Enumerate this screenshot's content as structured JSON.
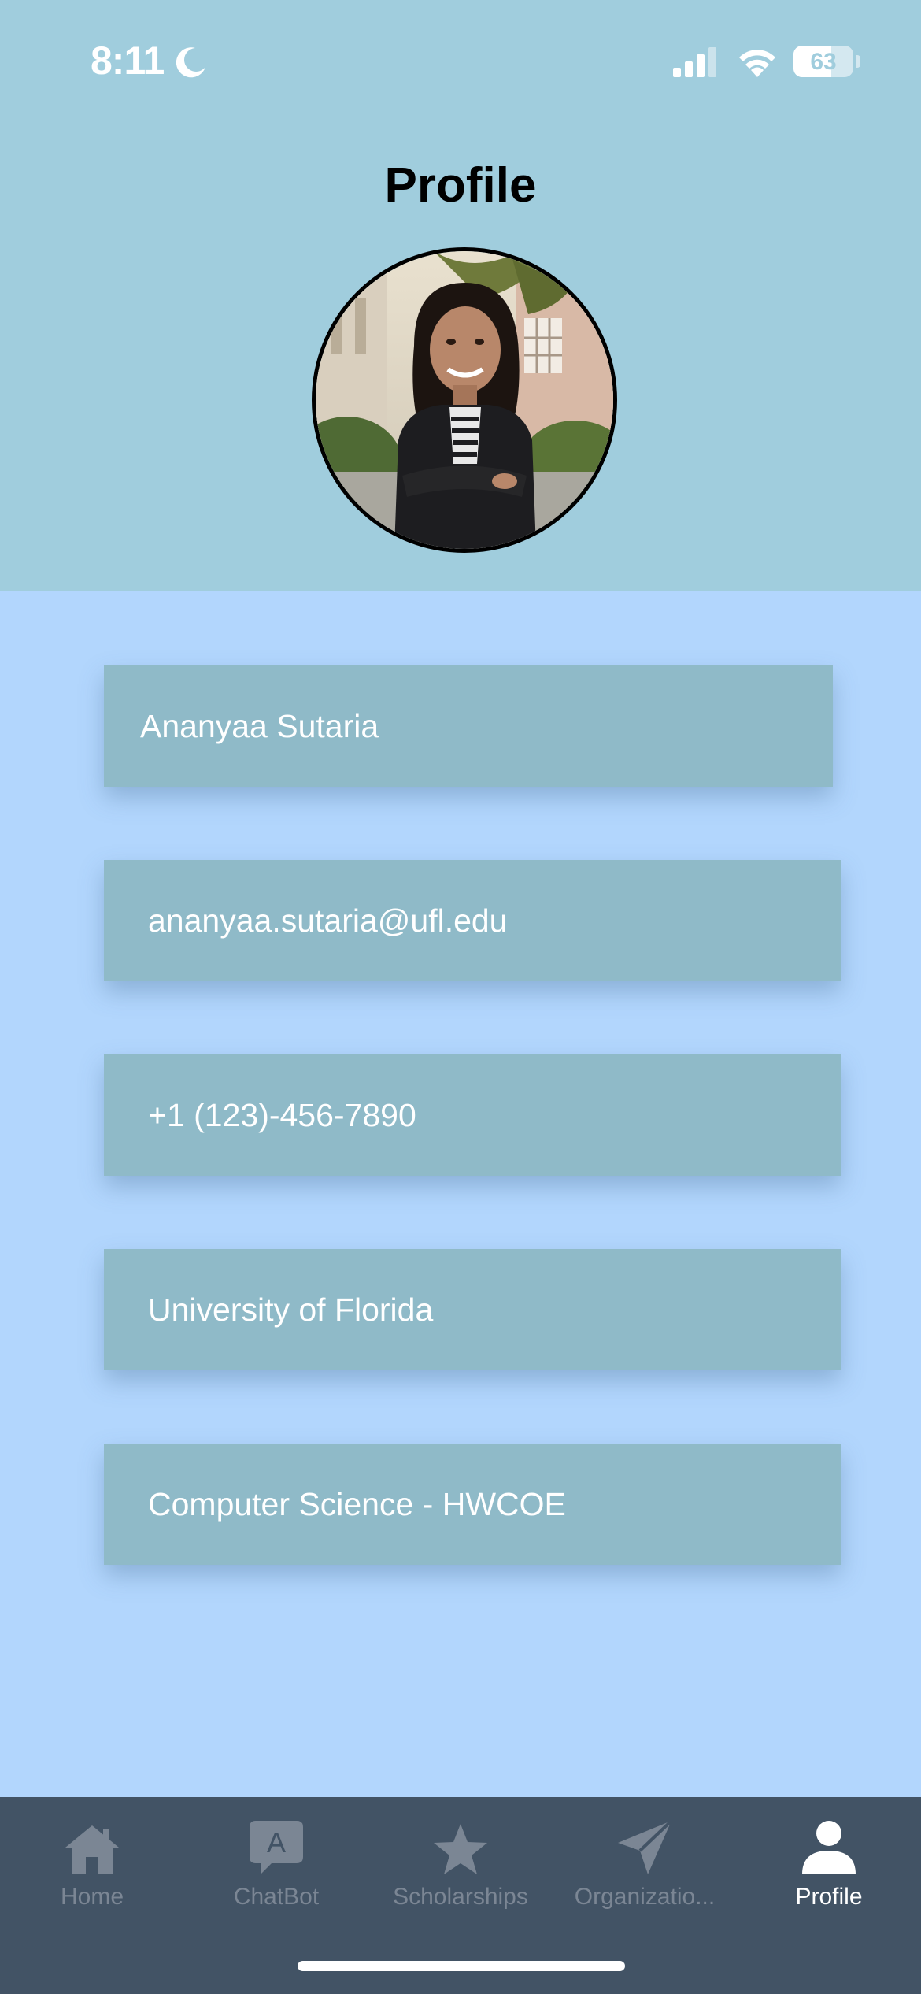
{
  "status_bar": {
    "time": "8:11",
    "battery": "63",
    "battery_level": 0.63
  },
  "header": {
    "title": "Profile"
  },
  "profile": {
    "name": "Ananyaa Sutaria",
    "email": "ananyaa.sutaria@ufl.edu",
    "phone": "+1 (123)-456-7890",
    "university": "University of Florida",
    "major": "Computer Science - HWCOE"
  },
  "tabs": [
    {
      "label": "Home",
      "icon": "home-icon",
      "active": false
    },
    {
      "label": "ChatBot",
      "icon": "chat-bubble-icon",
      "active": false
    },
    {
      "label": "Scholarships",
      "icon": "star-icon",
      "active": false
    },
    {
      "label": "Organizatio...",
      "icon": "paper-plane-icon",
      "active": false
    },
    {
      "label": "Profile",
      "icon": "person-icon",
      "active": true
    }
  ],
  "colors": {
    "header_bg": "#a0cddd",
    "page_bg": "#b2d6fd",
    "field_bg": "#8fbac8",
    "tabbar_bg": "#425365",
    "tab_inactive": "#7b8694",
    "tab_active": "#ffffff"
  }
}
